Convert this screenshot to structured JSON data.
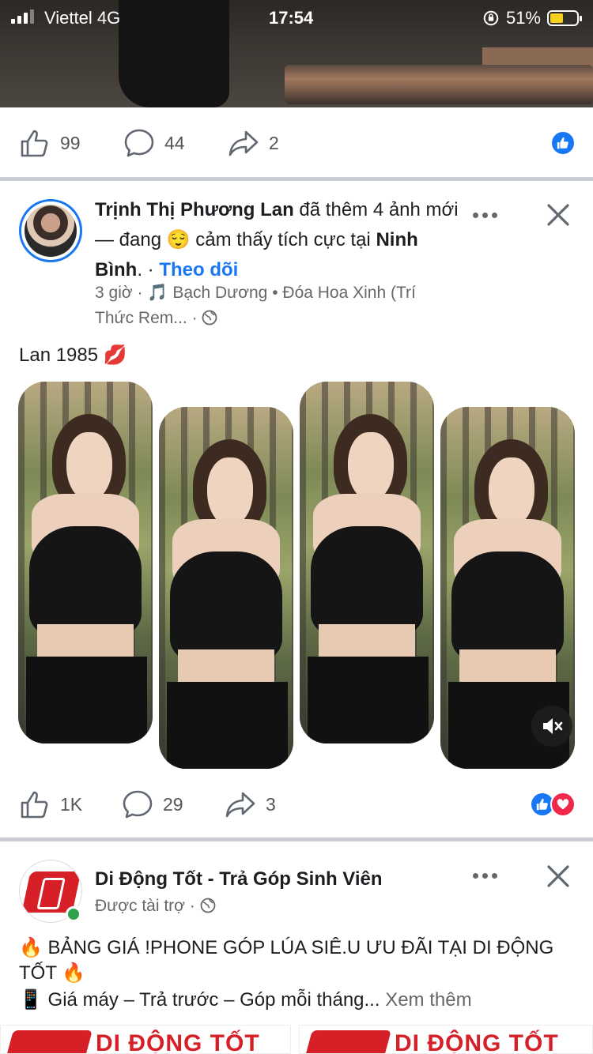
{
  "status_bar": {
    "carrier": "Viettel",
    "network": "4G",
    "time": "17:54",
    "battery": "51%",
    "battery_level": 0.51
  },
  "post1": {
    "likes": "99",
    "comments": "44",
    "shares": "2"
  },
  "post2": {
    "author": "Trịnh Thị Phương Lan",
    "action": " đã thêm 4 ảnh mới — đang ",
    "feeling_emoji": "😌",
    "feeling": "  cảm thấy tích cực tại ",
    "location": "Ninh Bình",
    "location_suffix": ". · ",
    "follow": "Theo dõi",
    "time": "3 giờ",
    "music": "Bạch Dương",
    "song": "Đóa Hoa Xinh (Trí Thức Rem...",
    "caption": "Lan 1985 💋",
    "likes": "1K",
    "comments": "29",
    "shares": "3"
  },
  "post3": {
    "author": "Di Động Tốt - Trả Góp Sinh Viên",
    "sponsored": "Được tài trợ",
    "line1": "🔥 BẢNG GIÁ !PHONE GÓP LÚA SIÊ.U ƯU ĐÃI TẠI DI ĐỘNG TỐT 🔥",
    "line2": "📱 Giá máy – Trả trước – Góp mỗi tháng... ",
    "see_more": "Xem thêm",
    "banner_label": "DI ĐỘNG TỐT"
  },
  "colors": {
    "accent": "#1877f2",
    "love": "#f0284a",
    "brand_red": "#d61f26"
  }
}
